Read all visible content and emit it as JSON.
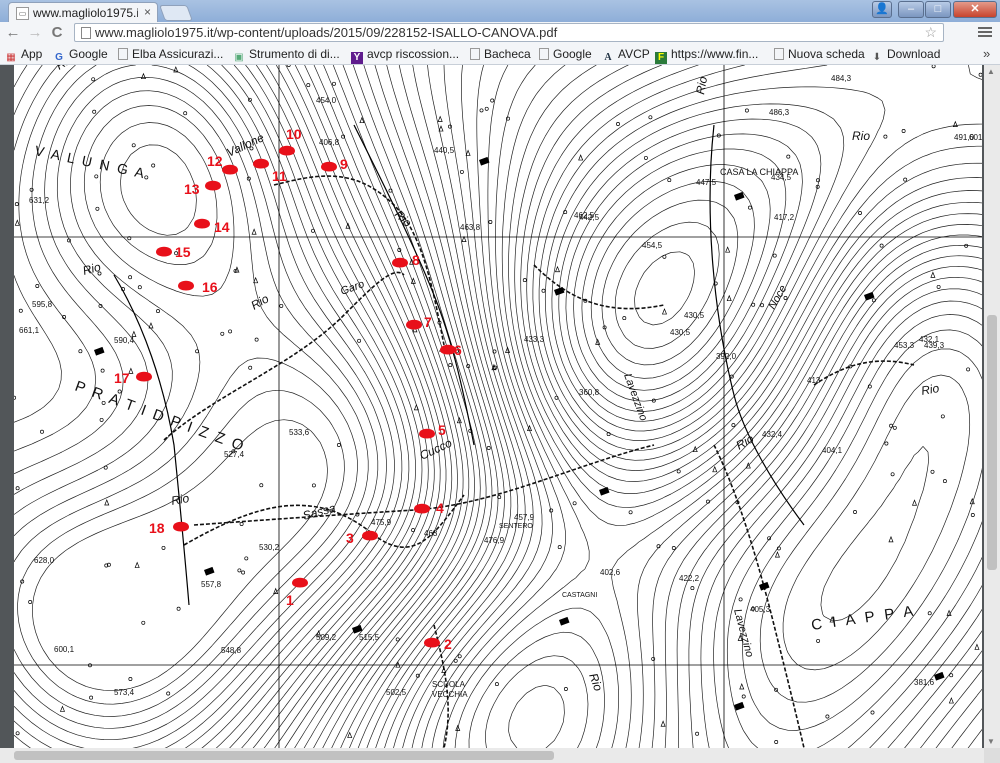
{
  "window": {
    "tab_title": "www.magliolo1975.i",
    "tab_close": "×",
    "win_user": "👤",
    "win_min": "–",
    "win_max": "□",
    "win_close": "✕"
  },
  "toolbar": {
    "back": "←",
    "forward": "→",
    "reload": "C",
    "url": "www.magliolo1975.it/wp-content/uploads/2015/09/228152-ISALLO-CANOVA.pdf",
    "star": "☆"
  },
  "bookmarks": {
    "items": [
      {
        "label": "App",
        "icon": "apps-grid-icon"
      },
      {
        "label": "Google",
        "icon": "google-icon"
      },
      {
        "label": "Elba Assicurazi...",
        "icon": "page-icon"
      },
      {
        "label": "Strumento di di...",
        "icon": "image-icon"
      },
      {
        "label": "avcp riscossion...",
        "icon": "yahoo-icon"
      },
      {
        "label": "Bacheca",
        "icon": "page-icon"
      },
      {
        "label": "Google",
        "icon": "page-icon"
      },
      {
        "label": "AVCP",
        "icon": "a-logo-icon"
      },
      {
        "label": "https://www.fin...",
        "icon": "f-logo-icon"
      },
      {
        "label": "Nuova scheda",
        "icon": "page-icon"
      },
      {
        "label": "Download",
        "icon": "download-icon"
      }
    ],
    "more": "»"
  },
  "map": {
    "place_names": {
      "valunga": "V A L U N G A",
      "prati_di_pizzo": "P R A T I   D   P I Z Z O",
      "vallone": "Vallone",
      "casa_la_chiappa": "CASA LA CHIAPPA",
      "ciappa": "C I A P P A",
      "scuola_vecchia_1": "SCUOLA",
      "scuola_vecchia_2": "VECCHIA",
      "sassa": "Sassa",
      "cucco": "Cucco",
      "garo": "Garo",
      "sentiero": "SENTERO",
      "castagni": "CASTAGNI",
      "lavezzino": "Lavezzino",
      "lavezzino2": "Lavezzino",
      "noce": "Noce"
    },
    "rio_labels": [
      "Rio",
      "Rio",
      "Rio",
      "Rio",
      "Rio",
      "Rio",
      "Rio",
      "Rio",
      "Rio",
      "Rio"
    ],
    "elevations": [
      "454,0",
      "406,8",
      "463,8",
      "462,5",
      "454,5",
      "430,5",
      "530,2",
      "527,4",
      "533,6",
      "475,9",
      "476,9",
      "463",
      "457,9",
      "502,5",
      "509,2",
      "515,5",
      "557,8",
      "548,8",
      "573,4",
      "600,1",
      "628,0",
      "590,4",
      "595,8",
      "661,1",
      "631,2",
      "440,5",
      "430,5",
      "392,0",
      "360,8",
      "402,6",
      "422,2",
      "405,3",
      "432,4",
      "413",
      "404,1",
      "381,6",
      "453,3",
      "432,1",
      "439,3",
      "601,9",
      "491,0",
      "486,3",
      "484,3",
      "447,5",
      "434,5",
      "417,2",
      "433,3",
      "442,5",
      "413,3"
    ],
    "markers": [
      "1",
      "2",
      "3",
      "4",
      "5",
      "6",
      "7",
      "8",
      "9",
      "10",
      "11",
      "12",
      "13",
      "14",
      "15",
      "16",
      "17",
      "18"
    ]
  }
}
